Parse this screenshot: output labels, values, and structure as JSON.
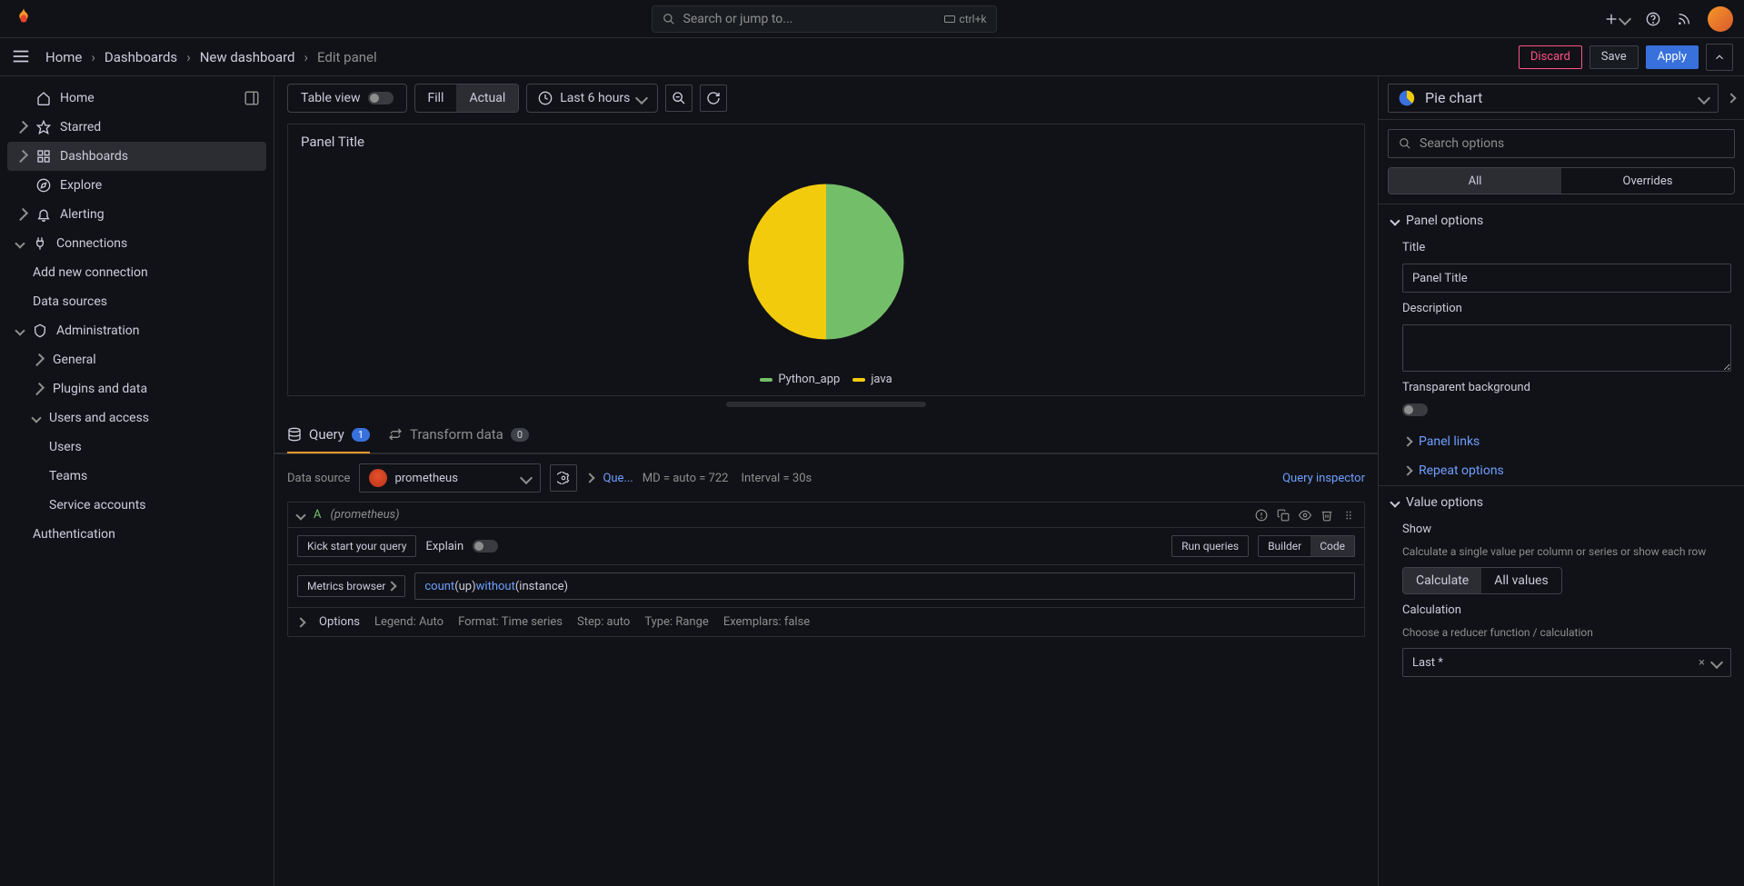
{
  "topbar": {
    "search_placeholder": "Search or jump to...",
    "kbd_hint": "ctrl+k"
  },
  "breadcrumbs": {
    "items": [
      "Home",
      "Dashboards",
      "New dashboard"
    ],
    "current": "Edit panel"
  },
  "header_actions": {
    "discard": "Discard",
    "save": "Save",
    "apply": "Apply"
  },
  "sidebar": {
    "home": "Home",
    "starred": "Starred",
    "dashboards": "Dashboards",
    "explore": "Explore",
    "alerting": "Alerting",
    "connections": "Connections",
    "add_conn": "Add new connection",
    "data_sources": "Data sources",
    "administration": "Administration",
    "general": "General",
    "plugins": "Plugins and data",
    "users_access": "Users and access",
    "users": "Users",
    "teams": "Teams",
    "service_accounts": "Service accounts",
    "authentication": "Authentication"
  },
  "toolbar": {
    "table_view": "Table view",
    "fill": "Fill",
    "actual": "Actual",
    "time_range": "Last 6 hours"
  },
  "panel": {
    "title": "Panel Title",
    "legend": {
      "a": "Python_app",
      "b": "java"
    }
  },
  "chart_data": {
    "type": "pie",
    "title": "Panel Title",
    "series": [
      {
        "name": "Python_app",
        "value": 50,
        "color": "#73bf69"
      },
      {
        "name": "java",
        "value": 50,
        "color": "#f2cc0c"
      }
    ]
  },
  "tabs": {
    "query": "Query",
    "query_count": "1",
    "transform": "Transform data",
    "transform_count": "0"
  },
  "query": {
    "ds_label": "Data source",
    "ds_name": "prometheus",
    "que_link": "Que...",
    "md": "MD = auto = 722",
    "interval": "Interval = 30s",
    "inspector": "Query inspector",
    "q_letter": "A",
    "q_hint": "(prometheus)",
    "kick_start": "Kick start your query",
    "explain": "Explain",
    "run": "Run queries",
    "builder": "Builder",
    "code": "Code",
    "metrics_browser": "Metrics browser",
    "expr_count": "count",
    "expr_up": "(up)",
    "expr_without": " without",
    "expr_instance": "(instance)",
    "options": "Options",
    "legend": "Legend: Auto",
    "format": "Format: Time series",
    "step": "Step: auto",
    "type": "Type: Range",
    "exemplars": "Exemplars: false"
  },
  "rightpane": {
    "vis_name": "Pie chart",
    "search_placeholder": "Search options",
    "tab_all": "All",
    "tab_overrides": "Overrides",
    "panel_options": "Panel options",
    "title_label": "Title",
    "title_value": "Panel Title",
    "description_label": "Description",
    "transparent": "Transparent background",
    "panel_links": "Panel links",
    "repeat_options": "Repeat options",
    "value_options": "Value options",
    "show_label": "Show",
    "show_desc": "Calculate a single value per column or series or show each row",
    "calculate": "Calculate",
    "all_values": "All values",
    "calculation_label": "Calculation",
    "calculation_desc": "Choose a reducer function / calculation",
    "calculation_value": "Last *"
  }
}
